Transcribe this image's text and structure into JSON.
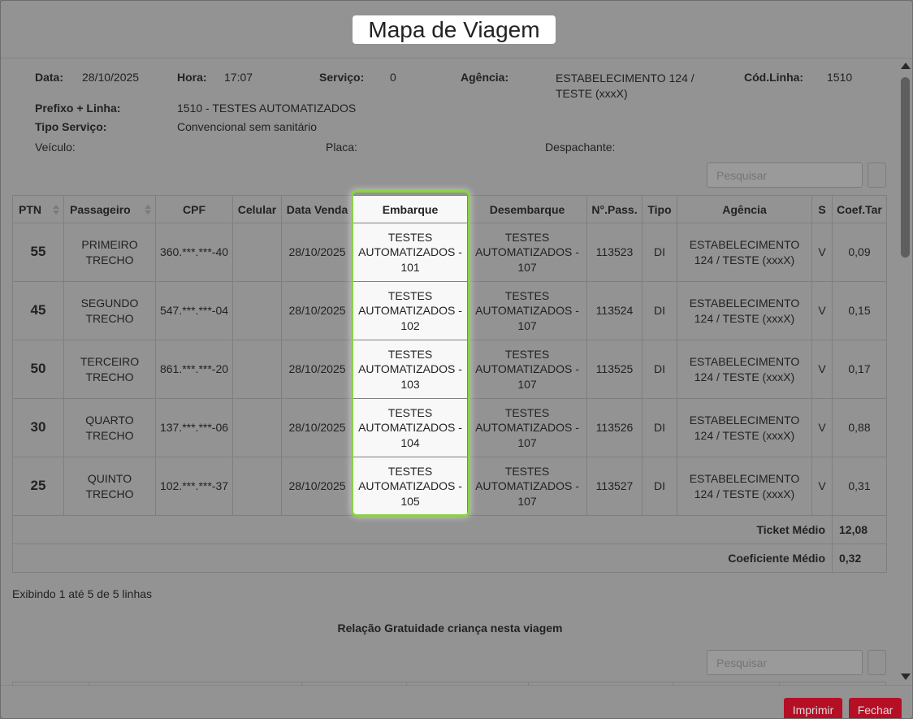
{
  "title": "Mapa de Viagem",
  "header": {
    "data_label": "Data:",
    "data_value": "28/10/2025",
    "hora_label": "Hora:",
    "hora_value": "17:07",
    "servico_label": "Serviço:",
    "servico_value": "0",
    "agencia_label": "Agência:",
    "agencia_value": "ESTABELECIMENTO 124 / TESTE (xxxX)",
    "codlinha_label": "Cód.Linha:",
    "codlinha_value": "1510",
    "prefixo_label": "Prefixo + Linha:",
    "prefixo_value": "1510 - TESTES AUTOMATIZADOS",
    "tipo_label": "Tipo Serviço:",
    "tipo_value": "Convencional sem sanitário",
    "veiculo_label": "Veículo:",
    "placa_label": "Placa:",
    "despachante_label": "Despachante:"
  },
  "search": {
    "placeholder": "Pesquisar"
  },
  "table": {
    "columns": [
      "PTN",
      "Passageiro",
      "CPF",
      "Celular",
      "Data Venda",
      "Embarque",
      "Desembarque",
      "N°.Pass.",
      "Tipo",
      "Agência",
      "S",
      "Coef.Tar"
    ],
    "rows": [
      {
        "ptn": "55",
        "passageiro": "PRIMEIRO TRECHO",
        "cpf": "360.***.***-40",
        "celular": "",
        "data_venda": "28/10/2025",
        "embarque": "TESTES AUTOMATIZADOS - 101",
        "desembarque": "TESTES AUTOMATIZADOS - 107",
        "npass": "113523",
        "tipo": "DI",
        "agencia": "ESTABELECIMENTO 124 / TESTE (xxxX)",
        "s": "V",
        "coef": "0,09"
      },
      {
        "ptn": "45",
        "passageiro": "SEGUNDO TRECHO",
        "cpf": "547.***.***-04",
        "celular": "",
        "data_venda": "28/10/2025",
        "embarque": "TESTES AUTOMATIZADOS - 102",
        "desembarque": "TESTES AUTOMATIZADOS - 107",
        "npass": "113524",
        "tipo": "DI",
        "agencia": "ESTABELECIMENTO 124 / TESTE (xxxX)",
        "s": "V",
        "coef": "0,15"
      },
      {
        "ptn": "50",
        "passageiro": "TERCEIRO TRECHO",
        "cpf": "861.***.***-20",
        "celular": "",
        "data_venda": "28/10/2025",
        "embarque": "TESTES AUTOMATIZADOS - 103",
        "desembarque": "TESTES AUTOMATIZADOS - 107",
        "npass": "113525",
        "tipo": "DI",
        "agencia": "ESTABELECIMENTO 124 / TESTE (xxxX)",
        "s": "V",
        "coef": "0,17"
      },
      {
        "ptn": "30",
        "passageiro": "QUARTO TRECHO",
        "cpf": "137.***.***-06",
        "celular": "",
        "data_venda": "28/10/2025",
        "embarque": "TESTES AUTOMATIZADOS - 104",
        "desembarque": "TESTES AUTOMATIZADOS - 107",
        "npass": "113526",
        "tipo": "DI",
        "agencia": "ESTABELECIMENTO 124 / TESTE (xxxX)",
        "s": "V",
        "coef": "0,88"
      },
      {
        "ptn": "25",
        "passageiro": "QUINTO TRECHO",
        "cpf": "102.***.***-37",
        "celular": "",
        "data_venda": "28/10/2025",
        "embarque": "TESTES AUTOMATIZADOS - 105",
        "desembarque": "TESTES AUTOMATIZADOS - 107",
        "npass": "113527",
        "tipo": "DI",
        "agencia": "ESTABELECIMENTO 124 / TESTE (xxxX)",
        "s": "V",
        "coef": "0,31"
      }
    ],
    "ticket_medio_label": "Ticket Médio",
    "ticket_medio_value": "12,08",
    "coef_medio_label": "Coeficiente Médio",
    "coef_medio_value": "0,32"
  },
  "pagination_info": "Exibindo 1 até 5 de 5 linhas",
  "section2_title": "Relação Gratuidade criança nesta viagem",
  "buttons": {
    "print": "Imprimir",
    "close": "Fechar"
  },
  "colors": {
    "focus_ring": "#8ad146",
    "button_bg": "#b50f26"
  },
  "icons": [
    "sort-icon",
    "search-button-icon",
    "scroll-up-icon",
    "scroll-down-icon"
  ]
}
